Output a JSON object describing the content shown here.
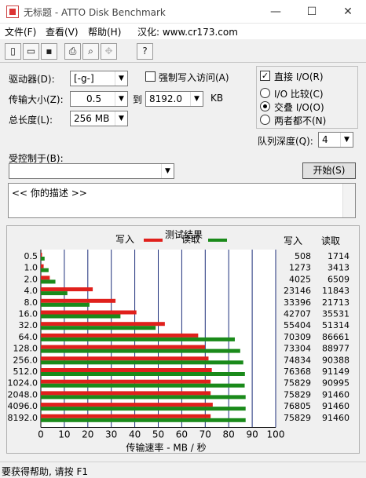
{
  "window": {
    "title": "无标题 - ATTO Disk Benchmark",
    "minimize": "—",
    "maximize": "☐",
    "close": "✕"
  },
  "menu": {
    "file": "文件(F)",
    "view": "查看(V)",
    "help": "帮助(H)",
    "localization": "汉化: www.cr173.com"
  },
  "toolbar": {
    "buttons": [
      {
        "icon": "new-document-icon",
        "glyph": "▯"
      },
      {
        "icon": "open-folder-icon",
        "glyph": "▭"
      },
      {
        "icon": "save-disk-icon",
        "glyph": "▪"
      },
      {
        "icon": "print-icon",
        "glyph": "⎙"
      },
      {
        "icon": "print-preview-icon",
        "glyph": "⌕"
      },
      {
        "icon": "move-icon",
        "glyph": "✥"
      },
      {
        "icon": "context-help-icon",
        "glyph": "?"
      }
    ]
  },
  "form": {
    "drive_label": "驱动器(D):",
    "drive_value": "[-g-]",
    "force_write_label": "强制写入访问(A)",
    "transfer_size_label": "传输大小(Z):",
    "transfer_from": "0.5",
    "to_label": "到",
    "transfer_to": "8192.0",
    "kb_label": "KB",
    "total_length_label": "总长度(L):",
    "total_length_value": "256 MB",
    "direct_io_label": "直接 I/O(R)",
    "io_compare_label": "I/O 比较(C)",
    "overlapped_io_label": "交叠 I/O(O)",
    "neither_label": "两者都不(N)",
    "queue_depth_label": "队列深度(Q):",
    "queue_depth_value": "4",
    "controlled_by_label": "受控制于(B):",
    "controlled_by_value": "",
    "start_button": "开始(S)",
    "description": "<< 你的描述 >>"
  },
  "results": {
    "title": "测试结果",
    "legend_write": "写入",
    "legend_read": "读取",
    "col_write": "写入",
    "col_read": "读取",
    "write_color": "#e0201c",
    "read_color": "#1a8a1a"
  },
  "chart_data": {
    "type": "bar",
    "orientation": "horizontal",
    "title": "测试结果",
    "xlabel": "传输速率 - MB / 秒",
    "xlim": [
      0,
      100
    ],
    "xticks": [
      "0",
      "10",
      "20",
      "30",
      "40",
      "50",
      "60",
      "70",
      "80",
      "90",
      "100"
    ],
    "categories": [
      "0.5",
      "1.0",
      "2.0",
      "4.0",
      "8.0",
      "16.0",
      "32.0",
      "64.0",
      "128.0",
      "256.0",
      "512.0",
      "1024.0",
      "2048.0",
      "4096.0",
      "8192.0"
    ],
    "series": [
      {
        "name": "写入",
        "values": [
          0.5,
          1.2,
          3.8,
          22.1,
          31.8,
          40.7,
          52.8,
          67.0,
          69.9,
          71.4,
          72.8,
          72.3,
          72.3,
          73.2,
          72.3
        ]
      },
      {
        "name": "读取",
        "values": [
          1.6,
          3.3,
          6.2,
          11.3,
          20.7,
          33.9,
          48.9,
          82.6,
          84.9,
          86.2,
          86.9,
          86.8,
          87.2,
          87.2,
          87.2
        ]
      }
    ],
    "table": {
      "write": [
        "508",
        "1273",
        "4025",
        "23146",
        "33396",
        "42707",
        "55404",
        "70309",
        "73304",
        "74834",
        "76368",
        "75829",
        "75829",
        "76805",
        "75829"
      ],
      "read": [
        "1714",
        "3413",
        "6509",
        "11843",
        "21713",
        "35531",
        "51314",
        "86661",
        "88977",
        "90388",
        "91149",
        "90995",
        "91460",
        "91460",
        "91460"
      ]
    },
    "grid": true,
    "legend": "top"
  },
  "status": {
    "text": "要获得帮助, 请按 F1"
  }
}
